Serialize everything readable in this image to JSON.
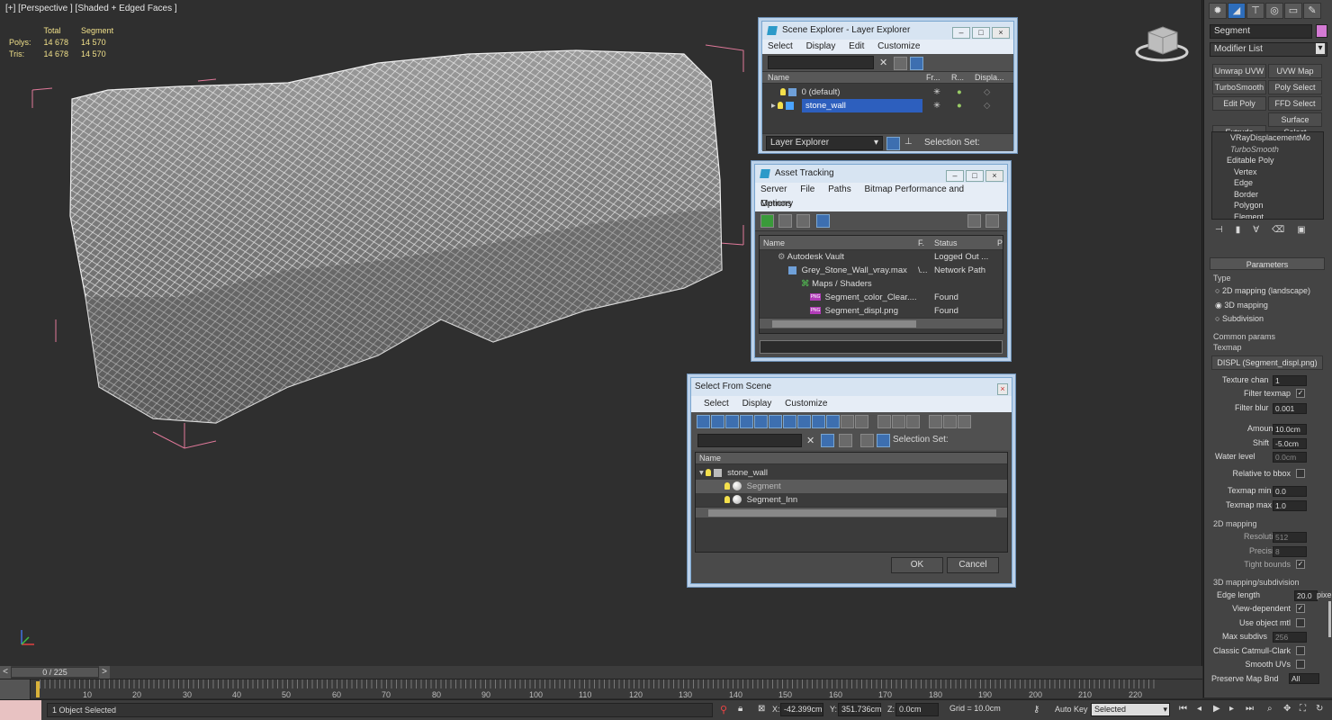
{
  "viewport": {
    "label": "[+] [Perspective ] [Shaded + Edged Faces ]",
    "stats": {
      "col_total": "Total",
      "col_segment": "Segment",
      "rows": [
        {
          "label": "Polys:",
          "total": "14 678",
          "segment": "14 570"
        },
        {
          "label": "Tris:",
          "total": "14 678",
          "segment": "14 570"
        }
      ]
    }
  },
  "scene_explorer": {
    "title": "Scene Explorer - Layer Explorer",
    "menu": [
      "Select",
      "Display",
      "Edit",
      "Customize"
    ],
    "columns": {
      "name": "Name",
      "frozen": "Fr...",
      "render": "R...",
      "display": "Displa..."
    },
    "rows": [
      "0 (default)",
      "stone_wall"
    ],
    "footer_mode": "Layer Explorer",
    "selection_set_label": "Selection Set:"
  },
  "asset_tracking": {
    "title": "Asset Tracking",
    "menu": [
      "Server",
      "File",
      "Paths",
      "Bitmap Performance and Memory"
    ],
    "menu2": "Options",
    "columns": {
      "name": "Name",
      "f": "F.",
      "status": "Status",
      "p": "P"
    },
    "rows": [
      {
        "name": "Autodesk Vault",
        "f": "",
        "status": "Logged Out ..."
      },
      {
        "name": "Grey_Stone_Wall_vray.max",
        "f": "\\...",
        "status": "Network Path"
      },
      {
        "name": "Maps / Shaders",
        "f": "",
        "status": ""
      },
      {
        "name": "Segment_color_Clear....",
        "f": "",
        "status": "Found"
      },
      {
        "name": "Segment_displ.png",
        "f": "",
        "status": "Found"
      }
    ],
    "png_badge": "PNG"
  },
  "select_from_scene": {
    "title": "Select From Scene",
    "menu": [
      "Select",
      "Display",
      "Customize"
    ],
    "selection_set_label": "Selection Set:",
    "column_name": "Name",
    "rows": [
      "stone_wall",
      "Segment",
      "Segment_Inn"
    ],
    "ok": "OK",
    "cancel": "Cancel"
  },
  "command_panel": {
    "object_name": "Segment",
    "modifier_list": "Modifier List",
    "modifier_buttons": [
      "Unwrap UVW",
      "UVW Map",
      "TurboSmooth",
      "Poly Select",
      "Edit Poly",
      "FFD Select",
      "Extrude",
      "Surface Select"
    ],
    "stack": [
      "VRayDisplacementMo",
      "TurboSmooth",
      "Editable Poly",
      "Vertex",
      "Edge",
      "Border",
      "Polygon",
      "Element"
    ],
    "parameters_title": "Parameters",
    "type_label": "Type",
    "type_options": [
      "2D mapping (landscape)",
      "3D mapping",
      "Subdivision"
    ],
    "common_params": "Common params",
    "texmap_label": "Texmap",
    "texmap_value": "DISPL (Segment_displ.png)",
    "texture_chan_label": "Texture chan",
    "texture_chan_value": "1",
    "filter_texmap_label": "Filter texmap",
    "filter_blur_label": "Filter blur",
    "filter_blur_value": "0.001",
    "amount_label": "Amount",
    "amount_value": "10.0cm",
    "shift_label": "Shift",
    "shift_value": "-5.0cm",
    "water_level_label": "Water level",
    "water_level_value": "0.0cm",
    "relative_bbox_label": "Relative to bbox",
    "texmap_min_label": "Texmap min",
    "texmap_min_value": "0.0",
    "texmap_max_label": "Texmap max",
    "texmap_max_value": "1.0",
    "mapping_2d": "2D mapping",
    "resolution_label": "Resolution",
    "resolution_value": "512",
    "precision_label": "Precision",
    "precision_value": "8",
    "tight_bounds_label": "Tight bounds",
    "mapping_3d": "3D mapping/subdivision",
    "edge_length_label": "Edge length",
    "edge_length_value": "20.0",
    "pixels_label": "pixels",
    "view_dependent_label": "View-dependent",
    "use_object_mtl_label": "Use object mtl",
    "max_subdivs_label": "Max subdivs",
    "max_subdivs_value": "256",
    "classic_label": "Classic Catmull-Clark",
    "smooth_uvs_label": "Smooth UVs",
    "preserve_label": "Preserve Map Bnd",
    "preserve_value": "All"
  },
  "timeline": {
    "frame_display": "0 / 225",
    "ticks": [
      "10",
      "20",
      "30",
      "40",
      "50",
      "60",
      "70",
      "80",
      "90",
      "100",
      "110",
      "120",
      "130",
      "140",
      "150",
      "160",
      "170",
      "180",
      "190",
      "200",
      "210",
      "220"
    ]
  },
  "status": {
    "selection_text": "1 Object Selected",
    "x_label": "X:",
    "x_value": "-42.399cm",
    "y_label": "Y:",
    "y_value": "351.736cm",
    "z_label": "Z:",
    "z_value": "0.0cm",
    "grid": "Grid = 10.0cm",
    "auto_key": "Auto Key",
    "selected_dropdown": "Selected"
  }
}
